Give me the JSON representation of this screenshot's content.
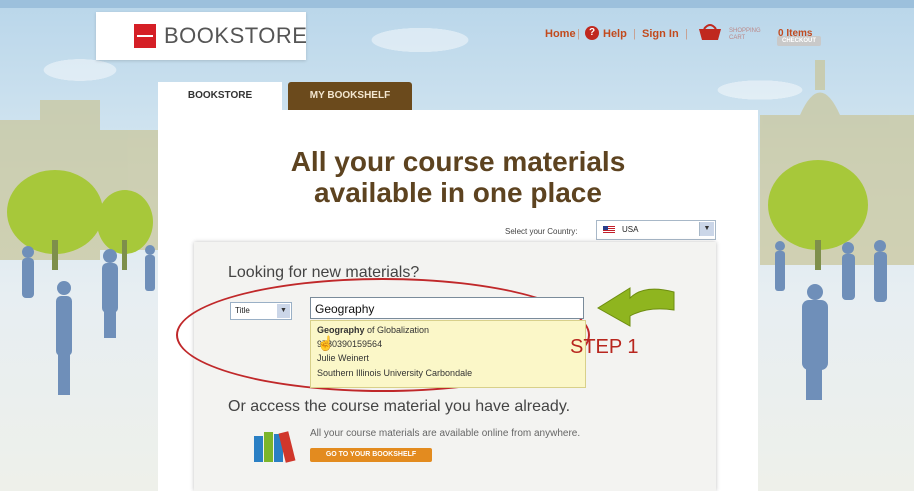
{
  "logo": {
    "text": "BOOKSTORE"
  },
  "nav": {
    "home": "Home",
    "help": "Help",
    "sign_in": "Sign In",
    "sep": "|",
    "cart_label_line1": "SHOPPING",
    "cart_label_line2": "CART",
    "items": "0 Items",
    "checkout": "CHECKOUT"
  },
  "tabs": [
    {
      "label": "BOOKSTORE",
      "active": true
    },
    {
      "label": "MY BOOKSHELF",
      "active": false
    }
  ],
  "headline": {
    "line1": "All your course materials",
    "line2": "available in one place"
  },
  "country": {
    "label": "Select your Country:",
    "value": "USA"
  },
  "search": {
    "heading": "Looking for new materials?",
    "type_value": "Title",
    "input_value": "Geography",
    "suggestion": {
      "title_bold": "Geography",
      "title_rest": " of Globalization",
      "isbn": "9780390159564",
      "author": "Julie Weinert",
      "school": "Southern Illinois University Carbondale"
    },
    "step_label": "STEP 1"
  },
  "bookshelf": {
    "heading": "Or access the course material you have already.",
    "text": "All your course materials are available online from anywhere.",
    "button": "GO TO YOUR BOOKSHELF"
  },
  "colors": {
    "accent": "#c24a1d",
    "brand_red": "#d51f26",
    "tab_brown": "#6b4a1c",
    "button_orange": "#e38b1f",
    "headline_brown": "#5d4320"
  }
}
